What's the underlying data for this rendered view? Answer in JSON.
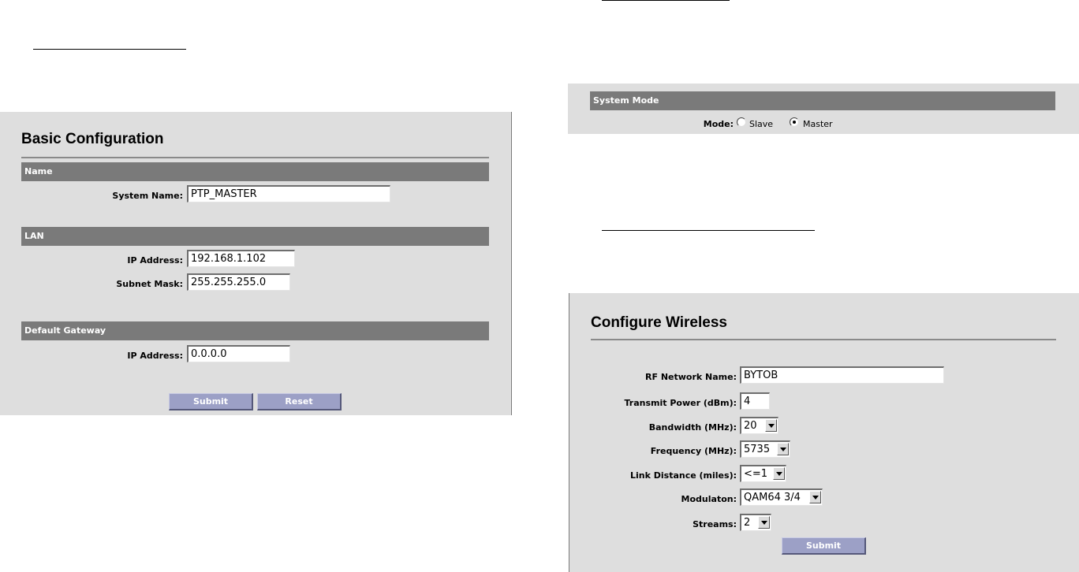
{
  "basic": {
    "title": "Basic Configuration",
    "name_section": "Name",
    "system_name_label": "System Name:",
    "system_name_value": "PTP_MASTER",
    "lan_section": "LAN",
    "ip_label": "IP Address:",
    "ip_value": "192.168.1.102",
    "subnet_label": "Subnet Mask:",
    "subnet_value": "255.255.255.0",
    "gateway_section": "Default Gateway",
    "gw_ip_label": "IP Address:",
    "gw_ip_value": "0.0.0.0",
    "submit_label": "Submit",
    "reset_label": "Reset"
  },
  "system_mode": {
    "section": "System Mode",
    "mode_label": "Mode:",
    "options": [
      "Slave",
      "Master"
    ],
    "selected": "Master"
  },
  "wireless": {
    "title": "Configure Wireless",
    "rf_name_label": "RF Network Name:",
    "rf_name_value": "BYTOB",
    "tx_power_label": "Transmit Power (dBm):",
    "tx_power_value": "4",
    "bandwidth_label": "Bandwidth (MHz):",
    "bandwidth_value": "20",
    "frequency_label": "Frequency (MHz):",
    "frequency_value": "5735",
    "link_distance_label": "Link Distance (miles):",
    "link_distance_value": "<=1",
    "modulation_label": "Modulaton:",
    "modulation_value": "QAM64 3/4",
    "streams_label": "Streams:",
    "streams_value": "2",
    "submit_label": "Submit"
  },
  "colors": {
    "panel_bg": "#dedede",
    "section_bar": "#7a7a7a",
    "button": "#9ca0c6"
  }
}
